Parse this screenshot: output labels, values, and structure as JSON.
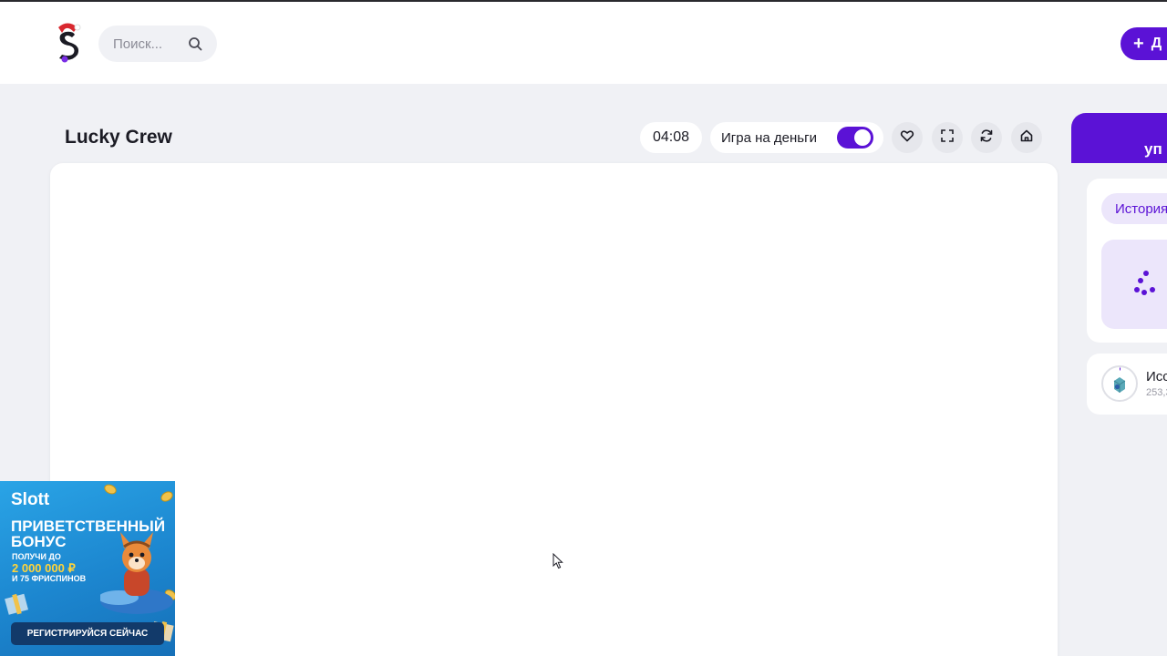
{
  "header": {
    "search": {
      "placeholder": "Поиск..."
    },
    "add_button_label": "Д"
  },
  "game": {
    "title": "Lucky Crew",
    "timer": "04:08",
    "money_toggle": {
      "label": "Игра на деньги",
      "on": true
    },
    "tools": [
      "heart-icon",
      "fullscreen-icon",
      "refresh-icon",
      "home-icon"
    ]
  },
  "sidebar": {
    "header_line1": "",
    "header_line2": "уп",
    "history_tab_label": "История",
    "winner": {
      "name": "Исс",
      "amount": "253,3"
    }
  },
  "ad": {
    "brand": "Slott",
    "title_line1": "ПРИВЕТСТВЕННЫЙ",
    "title_line2": "БОНУС",
    "subtitle1": "ПОЛУЧИ ДО",
    "amount": "2 000 000 ₽",
    "subtitle2": "И 75 ФРИСПИНОВ",
    "cta": "РЕГИСТРИРУЙСЯ СЕЙЧАС"
  },
  "colors": {
    "accent": "#5b12d6",
    "background": "#f0f1f5",
    "ad_blue": "#1c86cf",
    "ad_yellow": "#ffd43a"
  }
}
